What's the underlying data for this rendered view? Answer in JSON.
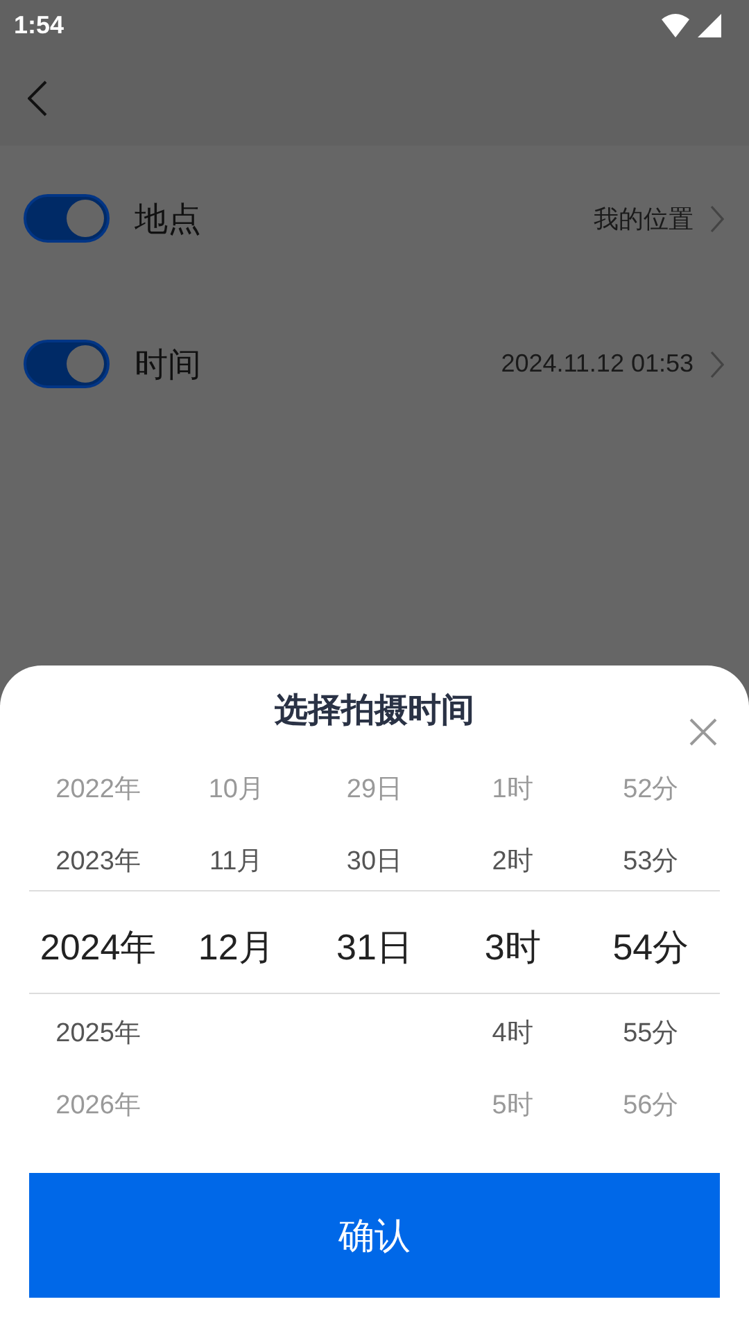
{
  "status_bar": {
    "time": "1:54"
  },
  "settings": [
    {
      "label": "地点",
      "on": true,
      "value": "我的位置"
    },
    {
      "label": "时间",
      "on": true,
      "value": "2024.11.12 01:53"
    }
  ],
  "picker": {
    "title": "选择拍摄时间",
    "columns": [
      {
        "items": [
          {
            "text": "2022年",
            "selected": false
          },
          {
            "text": "2023年",
            "selected": false
          },
          {
            "text": "2024年",
            "selected": true
          },
          {
            "text": "2025年",
            "selected": false
          },
          {
            "text": "2026年",
            "selected": false
          }
        ]
      },
      {
        "items": [
          {
            "text": "10月",
            "selected": false
          },
          {
            "text": "11月",
            "selected": false
          },
          {
            "text": "12月",
            "selected": true
          }
        ]
      },
      {
        "items": [
          {
            "text": "29日",
            "selected": false
          },
          {
            "text": "30日",
            "selected": false
          },
          {
            "text": "31日",
            "selected": true
          }
        ]
      },
      {
        "items": [
          {
            "text": "1时",
            "selected": false
          },
          {
            "text": "2时",
            "selected": false
          },
          {
            "text": "3时",
            "selected": true
          },
          {
            "text": "4时",
            "selected": false
          },
          {
            "text": "5时",
            "selected": false
          }
        ]
      },
      {
        "items": [
          {
            "text": "52分",
            "selected": false
          },
          {
            "text": "53分",
            "selected": false
          },
          {
            "text": "54分",
            "selected": true
          },
          {
            "text": "55分",
            "selected": false
          },
          {
            "text": "56分",
            "selected": false
          }
        ]
      }
    ],
    "confirm": "确认"
  }
}
